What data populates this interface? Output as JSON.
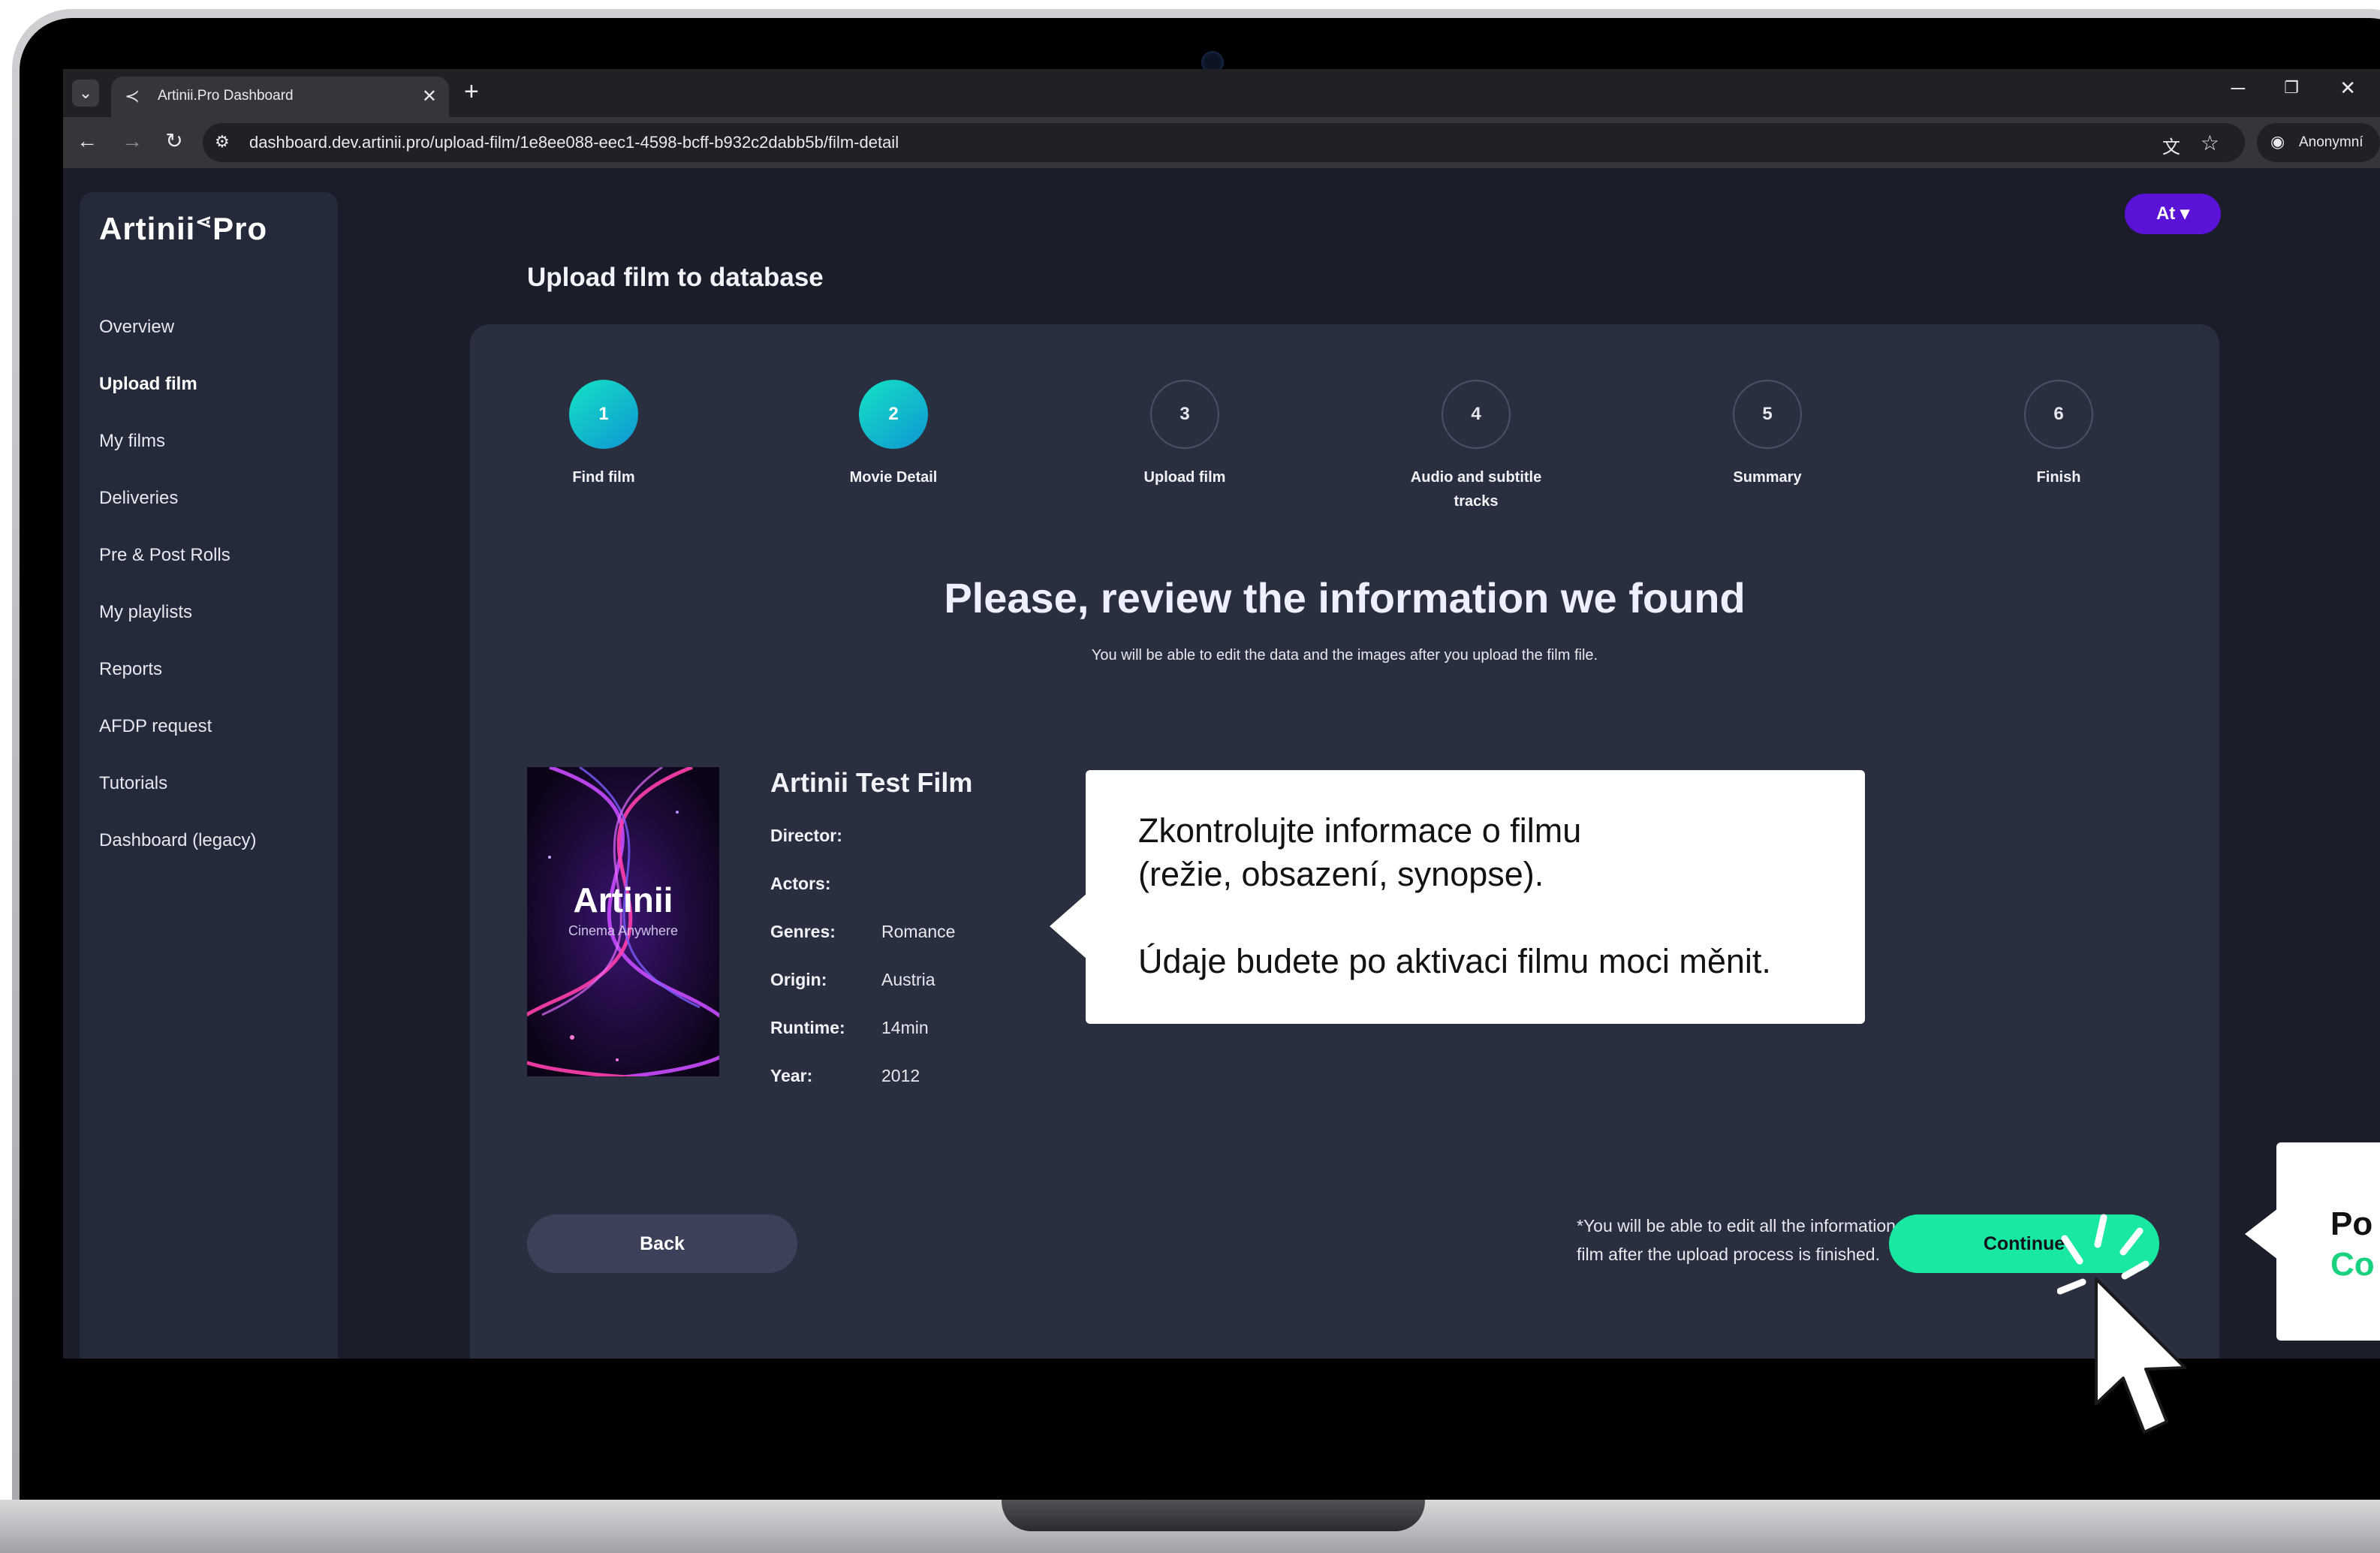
{
  "browser": {
    "tab_title": "Artinii.Pro Dashboard",
    "url": "dashboard.dev.artinii.pro/upload-film/1e8ee088-eec1-4598-bcff-b932c2dabb5b/film-detail",
    "profile_label": "Anonymní"
  },
  "sidebar": {
    "logo": "Artinii",
    "logo_suffix": "Pro",
    "items": [
      {
        "label": "Overview"
      },
      {
        "label": "Upload film"
      },
      {
        "label": "My films"
      },
      {
        "label": "Deliveries"
      },
      {
        "label": "Pre & Post Rolls"
      },
      {
        "label": "My playlists"
      },
      {
        "label": "Reports"
      },
      {
        "label": "AFDP request"
      },
      {
        "label": "Tutorials"
      },
      {
        "label": "Dashboard (legacy)"
      }
    ]
  },
  "header": {
    "language": "At",
    "page_title": "Upload film to database"
  },
  "steps": [
    {
      "number": "1",
      "label": "Find film"
    },
    {
      "number": "2",
      "label": "Movie Detail"
    },
    {
      "number": "3",
      "label": "Upload film"
    },
    {
      "number": "4",
      "label": "Audio and subtitle tracks"
    },
    {
      "number": "5",
      "label": "Summary"
    },
    {
      "number": "6",
      "label": "Finish"
    }
  ],
  "review": {
    "title": "Please, review the information we found",
    "subtitle": "You will be able to edit the data and the images after you upload the film file."
  },
  "film": {
    "poster_title": "Artinii",
    "poster_tagline": "Cinema Anywhere",
    "title": "Artinii Test Film",
    "fields": [
      {
        "label": "Director:",
        "value": ""
      },
      {
        "label": "Actors:",
        "value": ""
      },
      {
        "label": "Genres:",
        "value": "Romance"
      },
      {
        "label": "Origin:",
        "value": "Austria"
      },
      {
        "label": "Runtime:",
        "value": "14min"
      },
      {
        "label": "Year:",
        "value": "2012"
      }
    ]
  },
  "actions": {
    "back": "Back",
    "footnote": "*You will be able to edit all the information related to your film after the upload process is finished.",
    "continue": "Continue"
  },
  "overlay": {
    "callout_line1": "Zkontrolujte informace o filmu",
    "callout_line2": "(režie, obsazení, synopse).",
    "callout_line3": "Údaje budete po aktivaci filmu moci měnit.",
    "side_line1": "Po",
    "side_line2": "Co"
  },
  "colors": {
    "accent": "#19e8a2",
    "language_button": "#5a12d6",
    "step_done_start": "#14e3c4",
    "step_done_end": "#0f95d3",
    "background": "#1b1e2a",
    "card": "#2a2f40"
  }
}
